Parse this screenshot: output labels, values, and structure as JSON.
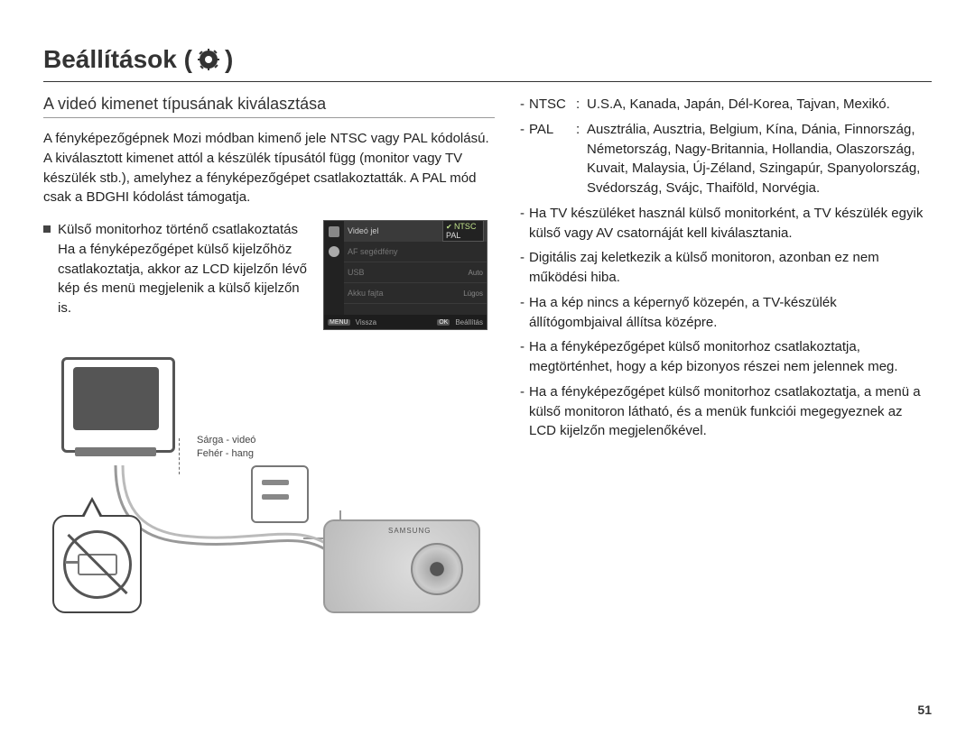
{
  "header": {
    "title_prefix": "Beállítások (",
    "title_suffix": ")"
  },
  "left": {
    "section_title": "A videó kimenet típusának kiválasztása",
    "intro": "A fényképezőgépnek Mozi módban kimenő jele NTSC vagy PAL kódolású. A kiválasztott kimenet attól a készülék típusától függ (monitor vagy TV készülék stb.), amelyhez a fényképezőgépet csatlakoztatták. A PAL mód csak a BDGHI kódolást támogatja.",
    "bullet_title": "Külső monitorhoz történő csatlakoztatás",
    "bullet_text": "Ha a fényképezőgépet külső kijelzőhöz csatlakoztatja, akkor az LCD kijelzőn lévő kép és menü megjelenik a külső kijelzőn is.",
    "cable_notes": {
      "yellow": "Sárga - videó",
      "white": "Fehér - hang"
    },
    "camera_brand": "SAMSUNG"
  },
  "camera_menu": {
    "rows": [
      {
        "label": "Videó jel",
        "options": [
          "NTSC",
          "PAL"
        ],
        "selected": "NTSC"
      },
      {
        "label": "AF segédfény",
        "value": ""
      },
      {
        "label": "USB",
        "value": "Auto"
      },
      {
        "label": "Akku fajta",
        "value": "Lúgos"
      }
    ],
    "footer": {
      "back_key": "MENU",
      "back_label": "Vissza",
      "ok_key": "OK",
      "ok_label": "Beállítás"
    }
  },
  "right": {
    "defs": [
      {
        "key": "NTSC",
        "val": "U.S.A, Kanada, Japán, Dél-Korea, Tajvan, Mexikó."
      },
      {
        "key": "PAL",
        "val": "Ausztrália, Ausztria, Belgium, Kína, Dánia, Finnország, Németország, Nagy-Britannia, Hollandia, Olaszország, Kuvait, Malaysia, Új-Zéland, Szingapúr, Spanyolország, Svédország, Svájc, Thaiföld, Norvégia."
      }
    ],
    "bullets": [
      "Ha TV készüléket használ külső monitorként, a TV készülék egyik külső vagy AV csatornáját kell kiválasztania.",
      "Digitális zaj keletkezik a külső monitoron, azonban ez nem működési hiba.",
      "Ha a kép nincs a képernyő közepén, a TV-készülék állítógombjaival állítsa középre.",
      "Ha a fényképezőgépet külső monitorhoz csatlakoztatja, megtörténhet, hogy a kép bizonyos részei nem jelennek meg.",
      "Ha a fényképezőgépet külső monitorhoz csatlakoztatja, a menü a külső monitoron látható, és a menük funkciói megegyeznek az LCD kijelzőn megjelenőkével."
    ]
  },
  "page_number": "51"
}
